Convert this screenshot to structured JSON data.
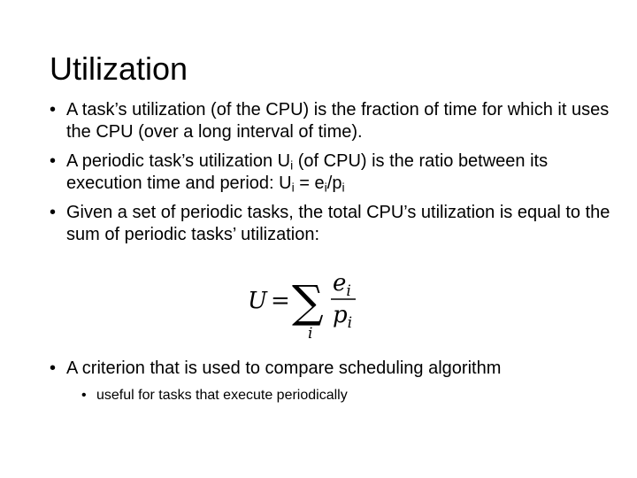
{
  "slide": {
    "title": "Utilization",
    "bullet1": "A task’s utilization (of the CPU) is the fraction of time for which it uses the CPU (over a long interval of time).",
    "bullet2": {
      "part1": "A periodic task’s utilization U",
      "sub_i": "i",
      "part2": " (of  CPU)  is the ratio between its execution time and period: U",
      "part3": " = e",
      "part4": "/p"
    },
    "bullet3": "Given a set of periodic tasks, the total CPU’s utilization is equal to the sum of periodic tasks’ utilization:",
    "formula": {
      "lhs": "U",
      "equals": "=",
      "sigma": "∑",
      "index": "i",
      "numerator_base": "e",
      "numerator_sub": "i",
      "denominator_base": "p",
      "denominator_sub": "i"
    },
    "bullet4": "A criterion that is used to compare scheduling algorithm",
    "subbullet1": "useful for tasks that execute periodically"
  }
}
